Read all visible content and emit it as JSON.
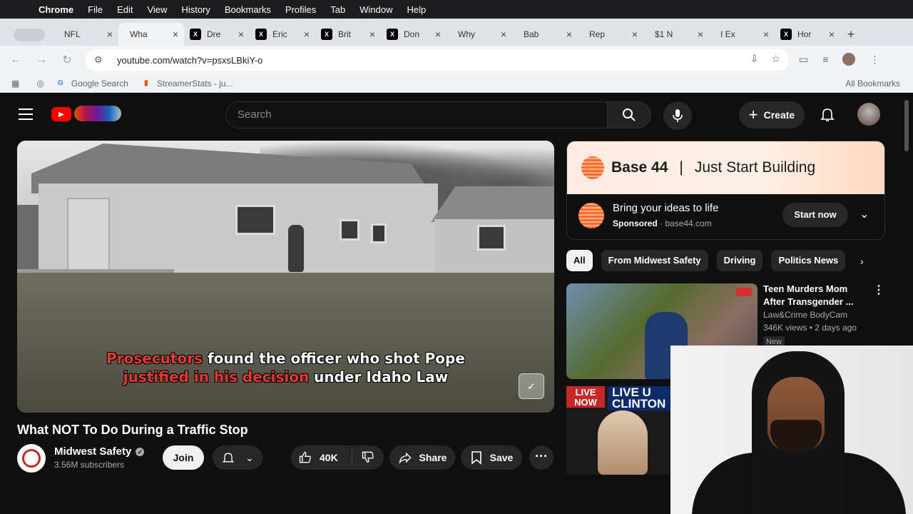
{
  "macos_menu": {
    "apple": "",
    "items": [
      "Chrome",
      "File",
      "Edit",
      "View",
      "History",
      "Bookmarks",
      "Profiles",
      "Tab",
      "Window",
      "Help"
    ]
  },
  "tabs": [
    {
      "label": "NFL",
      "icon": "youtube-icon",
      "active": false
    },
    {
      "label": "Wha",
      "icon": "youtube-icon",
      "active": true
    },
    {
      "label": "Dre",
      "icon": "x-icon",
      "active": false
    },
    {
      "label": "Eric",
      "icon": "x-icon",
      "active": false
    },
    {
      "label": "Brit",
      "icon": "x-icon",
      "active": false
    },
    {
      "label": "Don",
      "icon": "x-icon",
      "active": false
    },
    {
      "label": "Why",
      "icon": "youtube-icon",
      "active": false
    },
    {
      "label": "Bab",
      "icon": "youtube-icon",
      "active": false
    },
    {
      "label": "Rep",
      "icon": "youtube-icon",
      "active": false
    },
    {
      "label": "$1 N",
      "icon": "youtube-icon",
      "active": false
    },
    {
      "label": "I Ex",
      "icon": "youtube-icon",
      "active": false
    },
    {
      "label": "Hor",
      "icon": "x-icon",
      "active": false
    }
  ],
  "address_bar": {
    "url": "youtube.com/watch?v=psxsLBkiY-o"
  },
  "bookmarks_bar": {
    "items": [
      "Google Search",
      "StreamerStats - ju..."
    ],
    "all_bookmarks": "All Bookmarks"
  },
  "youtube": {
    "search_placeholder": "Search",
    "create_label": "Create",
    "video": {
      "caption_line1_red": "Prosecutors",
      "caption_line1_rest": " found the officer who shot Pope",
      "caption_line2_red": "justified in his decision",
      "caption_line2_rest": " under Idaho Law",
      "title": "What NOT To Do During a Traffic Stop",
      "channel": "Midwest Safety",
      "subscribers": "3.56M subscribers",
      "join_label": "Join",
      "likes": "40K",
      "share_label": "Share",
      "save_label": "Save"
    },
    "ad": {
      "brand": "Base 44",
      "separator": "|",
      "tagline": "Just Start Building",
      "headline": "Bring your ideas to life",
      "sponsored": "Sponsored",
      "domain": "base44.com",
      "cta": "Start now"
    },
    "chips": [
      "All",
      "From Midwest Safety",
      "Driving",
      "Politics News"
    ],
    "recommendations": [
      {
        "title": "Teen Murders Mom After Transgender ...",
        "channel": "Law&Crime BodyCam",
        "meta": "346K views • 2 days ago",
        "badge": "New"
      },
      {
        "thumb_badge": "LIVE NOW",
        "thumb_text": "LIVE U CLINTON"
      }
    ]
  },
  "colors": {
    "youtube_red": "#ff0000",
    "background": "#0f0f0f",
    "caption_red": "#e53935"
  }
}
